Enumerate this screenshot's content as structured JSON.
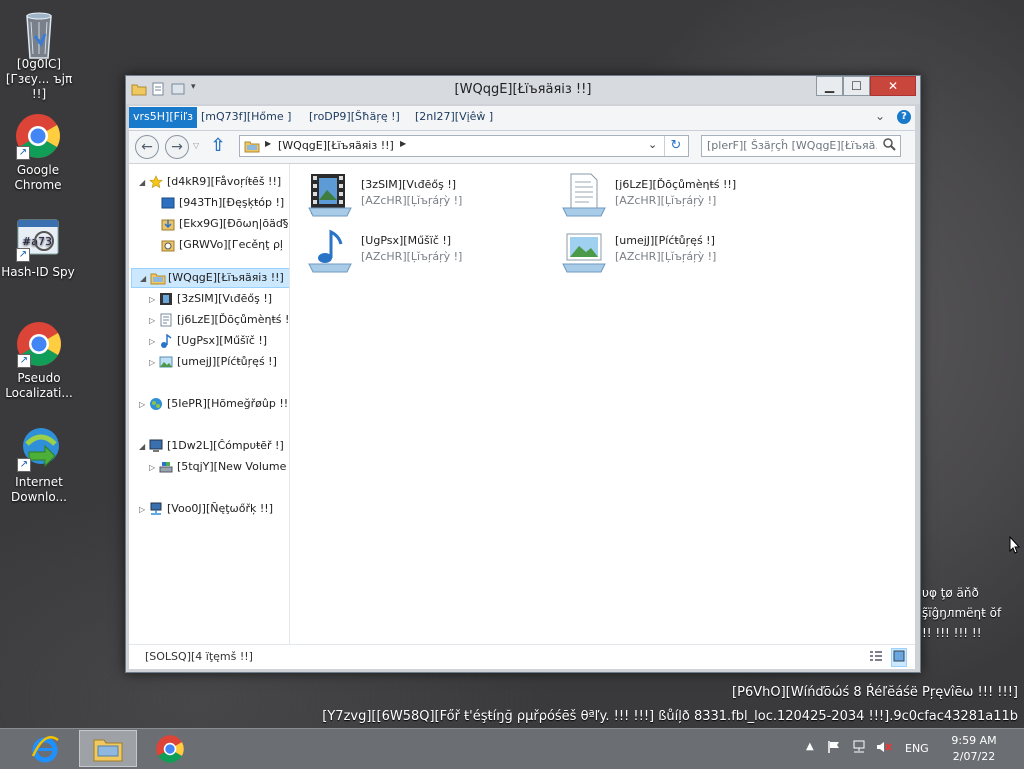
{
  "desktop": {
    "icons": [
      {
        "label": "[0g0IC][Гзєу... ъјπ !!]",
        "icon": "recycle-bin"
      },
      {
        "label": "Google Chrome",
        "icon": "chrome"
      },
      {
        "label": "Hash-ID Spy",
        "icon": "hash-id-spy"
      },
      {
        "label": "Pseudo Localizati...",
        "icon": "chrome"
      },
      {
        "label": "Internet Downlo...",
        "icon": "internet-download-manager"
      }
    ]
  },
  "window": {
    "title": "[WQqgE][Łїъяäяіз !!]",
    "minimize": "▁",
    "maximize": "☐",
    "close": "✕",
    "ribbon_tabs": {
      "file": "vrs5H][Fіľз",
      "home": "[mQ73f][Hőme ]",
      "share": "[roDP9][Šħäŗę !]",
      "view": "[2nI27][Vįêŵ ]"
    },
    "address_text": "[WQqgE][Łїъяäяіз !!]",
    "search_placeholder": "[plerF][ Šзäŗçĥ [WQqgE][Łїъяä...",
    "nav_tree": {
      "favorites": "[d4kR9][Fåvoŗíŧēš !!]",
      "desktop": "[943Th][Đęşķŧóp !]",
      "downloads": "[Ekx9G][Đōωη|ōäď§",
      "recent": "[GRWVo][Гесěηţ ρļ",
      "libraries": "[WQqgE][Łїъяäяіз !!]",
      "videos": "[3zSIM][Vιđēőş !]",
      "documents": "[j6LzE][Ďōçůmèηŧś !",
      "music": "[UgPsx][Műšïč !]",
      "pictures": "[umejJ][Píćŧůŗęś !]",
      "homegroup": "[5IePR][Hõmeğřøûp !!]",
      "computer": "[1Dw2L][Ĉómpυŧēř !]",
      "new_volume": "[5tqjY][New Volume",
      "network": "[Voo0J][Ñęţωőřķ !!]"
    },
    "libraries": [
      {
        "name": "[3zSIM][Vιđēőş !]",
        "type": "[AZcHR][Ļĭъŗáŗỳ !]",
        "icon": "videos-library"
      },
      {
        "name": "[j6LzE][Ďōçůmèηŧś !!]",
        "type": "[AZcHR][Ļĭъŗáŗỳ !]",
        "icon": "documents-library"
      },
      {
        "name": "[UgPsx][Műšïč !]",
        "type": "[AZcHR][Ļĭъŗáŗỳ !]",
        "icon": "music-library"
      },
      {
        "name": "[umejJ][Píćŧůŗęś !]",
        "type": "[AZcHR][Ļĭъŗáŗỳ !]",
        "icon": "pictures-library"
      }
    ],
    "status": "[SOLSQ][4 ïţęmš !!]"
  },
  "watermark": {
    "partial_lines": [
      "υφ ţø äňð",
      "ş̃ïĝŋлmëηŧ ŏf",
      "!! !!! !!! !!"
    ],
    "line1": "[P6VhO][Wíńďōώś 8 Ŕéľĕáśë Pŗęvîēω !!! !!!]",
    "line2": "[Y7zvg][[6W58Q][Főř ŧ'éşŧíŋğ ρµřρóśēš θªľy. !!! !!!] ßůíļð 8331.fbl_loc.120425-2034 !!!].9c0cfac43281a11b"
  },
  "taskbar": {
    "apps": [
      {
        "name": "internet-explorer"
      },
      {
        "name": "file-explorer"
      },
      {
        "name": "chrome"
      }
    ],
    "language": "ENG",
    "time": "9:59 AM",
    "date": "2/07/22"
  },
  "colors": {
    "accent": "#1979ca",
    "selection": "#cce8ff",
    "taskbar": "#6b6f74"
  }
}
